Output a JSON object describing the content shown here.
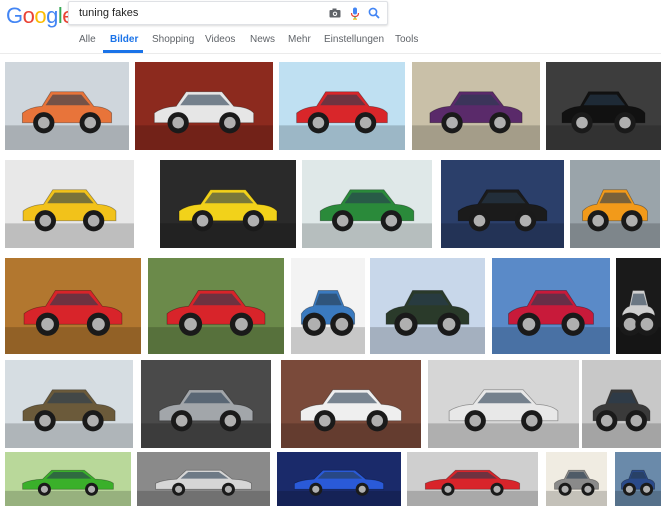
{
  "logo": {
    "letters": [
      "G",
      "o",
      "o",
      "g",
      "l",
      "e"
    ],
    "colors": [
      "#4285F4",
      "#EA4335",
      "#FBBC05",
      "#4285F4",
      "#34A853",
      "#EA4335"
    ]
  },
  "search": {
    "value": "tuning fakes",
    "camera_icon": "camera-icon",
    "mic_icon": "mic-icon",
    "search_icon": "search-icon"
  },
  "tabs": [
    {
      "label": "Alle"
    },
    {
      "label": "Bilder",
      "active": true
    },
    {
      "label": "Shopping"
    },
    {
      "label": "Videos"
    },
    {
      "label": "News"
    },
    {
      "label": "Mehr"
    },
    {
      "label": "Einstellungen"
    },
    {
      "label": "Tools"
    }
  ],
  "colors": {
    "accent": "#1a73e8",
    "tab_text": "#5f6368"
  },
  "images": {
    "row1": [
      {
        "name": "orange-tuned-sports-car",
        "bg": "#cfd6dc",
        "car": "#e8743a"
      },
      {
        "name": "white-audi-red-rims",
        "bg": "#8c2a1e",
        "car": "#e6e6e6"
      },
      {
        "name": "purple-and-red-opel-comparison",
        "bg": "#bfe0f2",
        "car": "#d9262a"
      },
      {
        "name": "purple-lada-yellow-doors",
        "bg": "#c9c0a8",
        "car": "#5a2a6a"
      },
      {
        "name": "black-lambo-door-car",
        "bg": "#3d3d3d",
        "car": "#111111"
      }
    ],
    "row2": [
      {
        "name": "yellow-black-bugatti-style",
        "bg": "#e8e8e8",
        "car": "#f2c21a"
      },
      {
        "name": "yellow-lambo-doors-hatchback",
        "bg": "#2a2a2a",
        "car": "#f2d21a"
      },
      {
        "name": "green-white-police-car",
        "bg": "#dfe8e8",
        "car": "#2a8a3a"
      },
      {
        "name": "black-car-at-diner",
        "bg": "#2b3f6a",
        "car": "#1b1b1b"
      },
      {
        "name": "orange-small-car-street",
        "bg": "#9aa4aa",
        "car": "#f29a1a"
      }
    ],
    "row3": [
      {
        "name": "red-convertible-jaguar",
        "bg": "#b2772f",
        "car": "#d8242a"
      },
      {
        "name": "red-golf-hatchback",
        "bg": "#6b8a4a",
        "car": "#d8242a"
      },
      {
        "name": "tuning-fakes-magazine-cover",
        "bg": "#f3f3f3",
        "car": "#3a7abf"
      },
      {
        "name": "green-black-fake-car",
        "bg": "#c8d7ea",
        "car": "#2a3a2a"
      },
      {
        "name": "red-concept-sports-car",
        "bg": "#5a8ac8",
        "car": "#c81a3a"
      },
      {
        "name": "dark-suv-night",
        "bg": "#1a1a1a",
        "car": "#cfcfcf"
      }
    ],
    "row4": [
      {
        "name": "offroad-lambo-doors",
        "bg": "#d6dde2",
        "car": "#6b5a3a"
      },
      {
        "name": "grey-bmw-suv",
        "bg": "#4a4a4a",
        "car": "#a2a6aa"
      },
      {
        "name": "white-lamborghini-rear",
        "bg": "#7a4a3a",
        "car": "#efefef"
      },
      {
        "name": "white-rolls-royce-style",
        "bg": "#d6d6d6",
        "car": "#e8e8e8"
      },
      {
        "name": "lada-rear-tuned",
        "bg": "#c8c8c8",
        "car": "#3a3a3a"
      }
    ],
    "row5": [
      {
        "name": "green-tuned-car",
        "bg": "#b9d89a",
        "car": "#3ab02a"
      },
      {
        "name": "silver-bmw-coupe",
        "bg": "#8a8a8a",
        "car": "#d6d6d6"
      },
      {
        "name": "blue-tuned-hatchback",
        "bg": "#1a2a6a",
        "car": "#2a5ad8"
      },
      {
        "name": "red-black-coupe",
        "bg": "#cfcfcf",
        "car": "#d8242a"
      },
      {
        "name": "magazine-page-car",
        "bg": "#f0ece2",
        "car": "#8a8a8a"
      },
      {
        "name": "blue-car-partial",
        "bg": "#6a8aaa",
        "car": "#2a4a8a"
      }
    ]
  }
}
